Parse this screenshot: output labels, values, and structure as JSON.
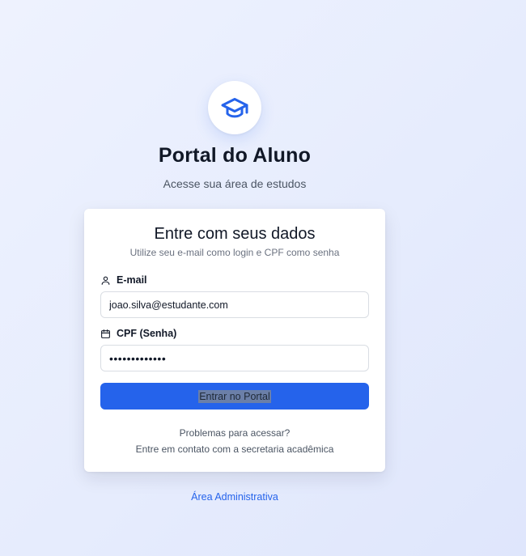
{
  "header": {
    "logo_icon": "graduation-cap-icon",
    "title": "Portal do Aluno",
    "subtitle": "Acesse sua área de estudos"
  },
  "card": {
    "title": "Entre com seus dados",
    "subtitle": "Utilize seu e-mail como login e CPF como senha",
    "email": {
      "icon": "user-icon",
      "label": "E-mail",
      "value": "joao.silva@estudante.com"
    },
    "cpf": {
      "icon": "calendar-icon",
      "label": "CPF (Senha)",
      "value": "•••••••••••••"
    },
    "submit_label": "Entrar no Portal",
    "help_question": "Problemas para acessar?",
    "help_contact": "Entre em contato com a secretaria acadêmica"
  },
  "footer": {
    "admin_link": "Área Administrativa"
  },
  "colors": {
    "accent": "#2563eb",
    "text": "#111827",
    "muted": "#6b7280"
  }
}
